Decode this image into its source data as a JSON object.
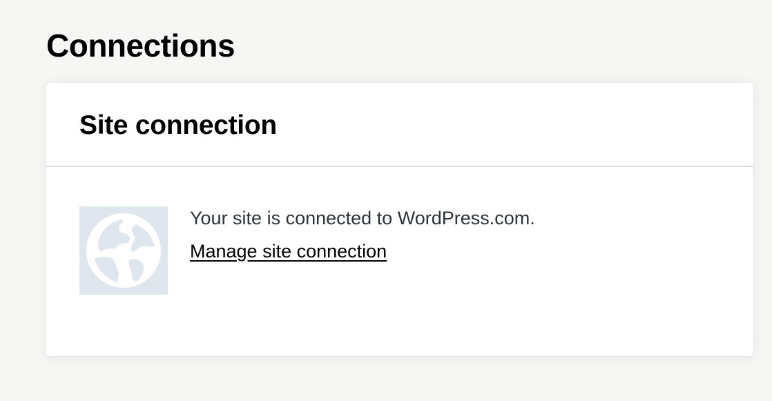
{
  "page": {
    "title": "Connections"
  },
  "site_connection": {
    "title": "Site connection",
    "status_text": "Your site is connected to WordPress.com.",
    "manage_link_label": "Manage site connection",
    "icon": "globe-icon"
  },
  "colors": {
    "background": "#f6f6f4",
    "card": "#ffffff",
    "icon_tile": "#dfe6ee",
    "icon_glyph": "#ffffff",
    "body_text": "#2c3338",
    "divider": "#dcdcde"
  }
}
